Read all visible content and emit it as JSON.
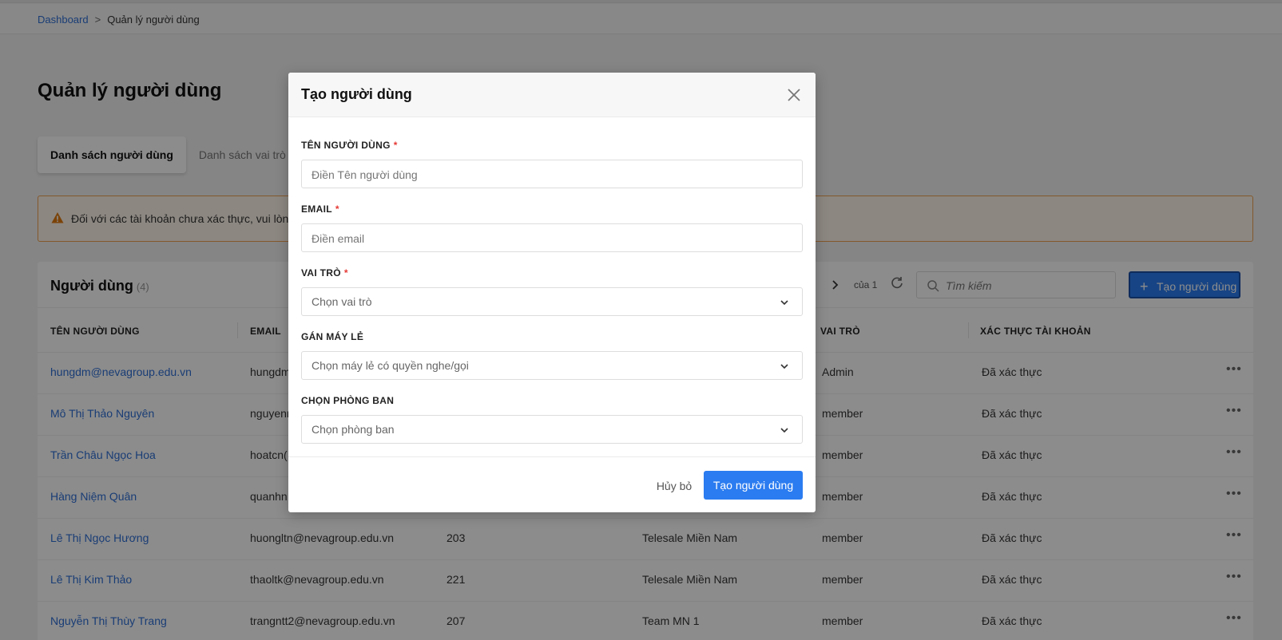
{
  "breadcrumb": {
    "root": "Dashboard",
    "separator": ">",
    "current": "Quản lý người dùng"
  },
  "page": {
    "title": "Quản lý người dùng"
  },
  "tabs": [
    {
      "label": "Danh sách người dùng",
      "active": true
    },
    {
      "label": "Danh sách vai trò",
      "active": false
    }
  ],
  "alert": {
    "text": "Đối với các tài khoản chưa xác thực, vui lòng"
  },
  "users_card": {
    "title": "Người dùng",
    "count": "(4)",
    "pager_of": "của 1",
    "search_placeholder": "Tìm kiếm",
    "create_label": "Tạo người dùng"
  },
  "table": {
    "columns": [
      "TÊN NGƯỜI DÙNG",
      "EMAIL",
      "VAI TRÒ",
      "XÁC THỰC TÀI KHOẢN"
    ],
    "rows": [
      {
        "name": "hungdm@nevagroup.edu.vn",
        "email": "hungdm",
        "ext": "",
        "dept": "",
        "role": "Admin",
        "verified": "Đã xác thực"
      },
      {
        "name": "Mô Thị Thảo Nguyên",
        "email": "nguyenn",
        "ext": "",
        "dept": "",
        "role": "member",
        "verified": "Đã xác thực"
      },
      {
        "name": "Trần Châu Ngọc Hoa",
        "email": "hoatcn(",
        "ext": "",
        "dept": "",
        "role": "member",
        "verified": "Đã xác thực"
      },
      {
        "name": "Hàng Niệm Quân",
        "email": "quanhn",
        "ext": "",
        "dept": "",
        "role": "member",
        "verified": "Đã xác thực"
      },
      {
        "name": "Lê Thị Ngọc Hương",
        "email": "huongltn@nevagroup.edu.vn",
        "ext": "203",
        "dept": "Telesale Miền Nam",
        "role": "member",
        "verified": "Đã xác thực"
      },
      {
        "name": "Lê Thị Kim Thảo",
        "email": "thaoltk@nevagroup.edu.vn",
        "ext": "221",
        "dept": "Telesale Miền Nam",
        "role": "member",
        "verified": "Đã xác thực"
      },
      {
        "name": "Nguyễn Thị Thùy Trang",
        "email": "trangntt2@nevagroup.edu.vn",
        "ext": "207",
        "dept": "Team MN 1",
        "role": "member",
        "verified": "Đã xác thực"
      }
    ]
  },
  "modal": {
    "title": "Tạo người dùng",
    "fields": {
      "username": {
        "label": "TÊN NGƯỜI DÙNG",
        "required": "*",
        "placeholder": "Điền Tên người dùng",
        "value": ""
      },
      "email": {
        "label": "EMAIL",
        "required": "*",
        "placeholder": "Điền email",
        "value": ""
      },
      "role": {
        "label": "VAI TRÒ",
        "required": "*",
        "selected": "Chọn vai trò"
      },
      "extension": {
        "label": "GÁN MÁY LẺ",
        "selected": "Chọn máy lẻ có quyền nghe/gọi"
      },
      "department": {
        "label": "CHỌN PHÒNG BAN",
        "selected": "Chọn phòng ban"
      }
    },
    "cancel_label": "Hủy bỏ",
    "submit_label": "Tạo người dùng"
  },
  "colors": {
    "primary": "#2b7cf0",
    "link": "#2f6fd6",
    "warning": "#f0a050",
    "required": "#e53935"
  }
}
